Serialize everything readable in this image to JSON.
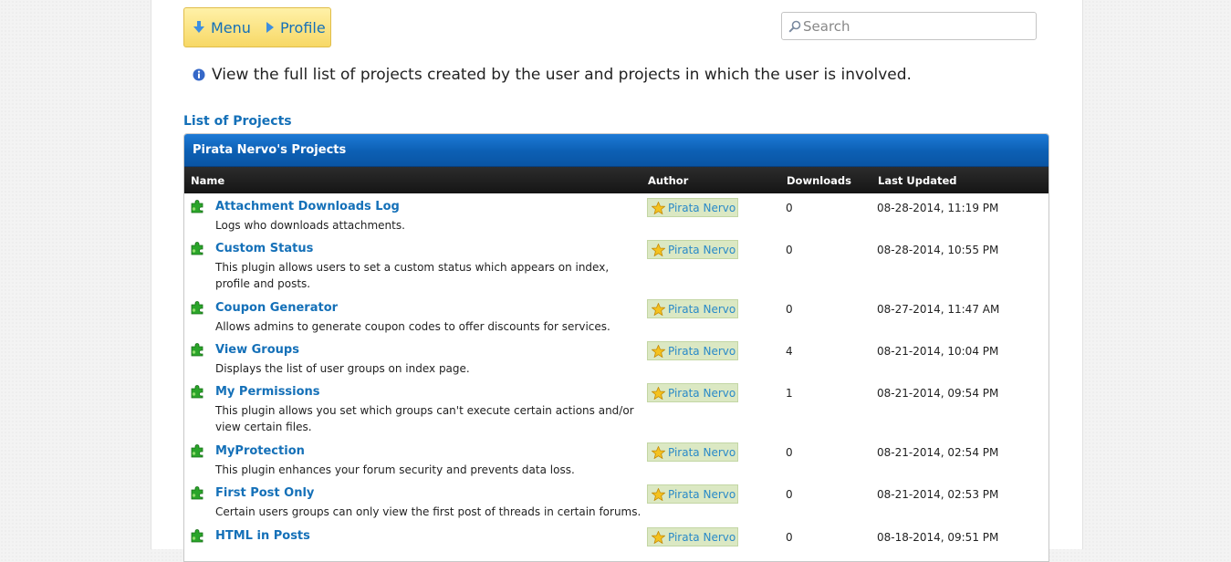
{
  "nav": {
    "menu_label": "Menu",
    "profile_label": "Profile"
  },
  "search": {
    "placeholder": "Search"
  },
  "info_text": "View the full list of projects created by the user and projects in which the user is involved.",
  "list_title": "List of Projects",
  "table": {
    "title": "Pirata Nervo's Projects",
    "columns": {
      "name": "Name",
      "author": "Author",
      "downloads": "Downloads",
      "updated": "Last Updated"
    },
    "rows": [
      {
        "name": "Attachment Downloads Log",
        "desc": "Logs who downloads attachments.",
        "author": "Pirata Nervo",
        "downloads": "0",
        "updated": "08-28-2014, 11:19 PM"
      },
      {
        "name": "Custom Status",
        "desc": "This plugin allows users to set a custom status which appears on index, profile and posts.",
        "author": "Pirata Nervo",
        "downloads": "0",
        "updated": "08-28-2014, 10:55 PM"
      },
      {
        "name": "Coupon Generator",
        "desc": "Allows admins to generate coupon codes to offer discounts for services.",
        "author": "Pirata Nervo",
        "downloads": "0",
        "updated": "08-27-2014, 11:47 AM"
      },
      {
        "name": "View Groups",
        "desc": "Displays the list of user groups on index page.",
        "author": "Pirata Nervo",
        "downloads": "4",
        "updated": "08-21-2014, 10:04 PM"
      },
      {
        "name": "My Permissions",
        "desc": "This plugin allows you set which groups can't execute certain actions and/or view certain files.",
        "author": "Pirata Nervo",
        "downloads": "1",
        "updated": "08-21-2014, 09:54 PM"
      },
      {
        "name": "MyProtection",
        "desc": "This plugin enhances your forum security and prevents data loss.",
        "author": "Pirata Nervo",
        "downloads": "0",
        "updated": "08-21-2014, 02:54 PM"
      },
      {
        "name": "First Post Only",
        "desc": "Certain users groups can only view the first post of threads in certain forums.",
        "author": "Pirata Nervo",
        "downloads": "0",
        "updated": "08-21-2014, 02:53 PM"
      },
      {
        "name": "HTML in Posts",
        "desc": "",
        "author": "Pirata Nervo",
        "downloads": "0",
        "updated": "08-18-2014, 09:51 PM"
      }
    ]
  }
}
